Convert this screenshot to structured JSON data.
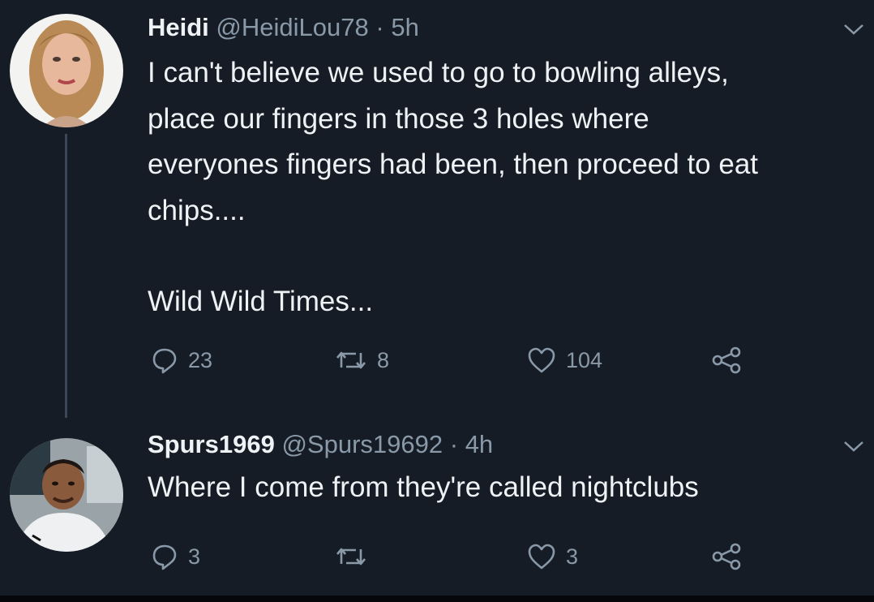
{
  "tweets": [
    {
      "name": "Heidi",
      "handle": "@HeidiLou78",
      "separator": "·",
      "time": "5h",
      "lines": [
        "I can't believe we used to go to bowling alleys,",
        "place our fingers in those 3 holes where",
        "everyones fingers had been, then proceed to eat",
        "chips....",
        "Wild Wild Times..."
      ],
      "replies": "23",
      "retweets": "8",
      "likes": "104"
    },
    {
      "name": "Spurs1969",
      "handle": "@Spurs19692",
      "separator": "·",
      "time": "4h",
      "lines": [
        "Where I come from they're called nightclubs"
      ],
      "replies": "3",
      "retweets": "",
      "likes": "3"
    }
  ],
  "icons": {
    "reply": "reply-icon",
    "retweet": "retweet-icon",
    "like": "heart-icon",
    "share": "share-icon",
    "caret": "chevron-down-icon"
  },
  "colors": {
    "background": "#151c26",
    "text": "#eef2f5",
    "secondary": "#8a99a8"
  }
}
